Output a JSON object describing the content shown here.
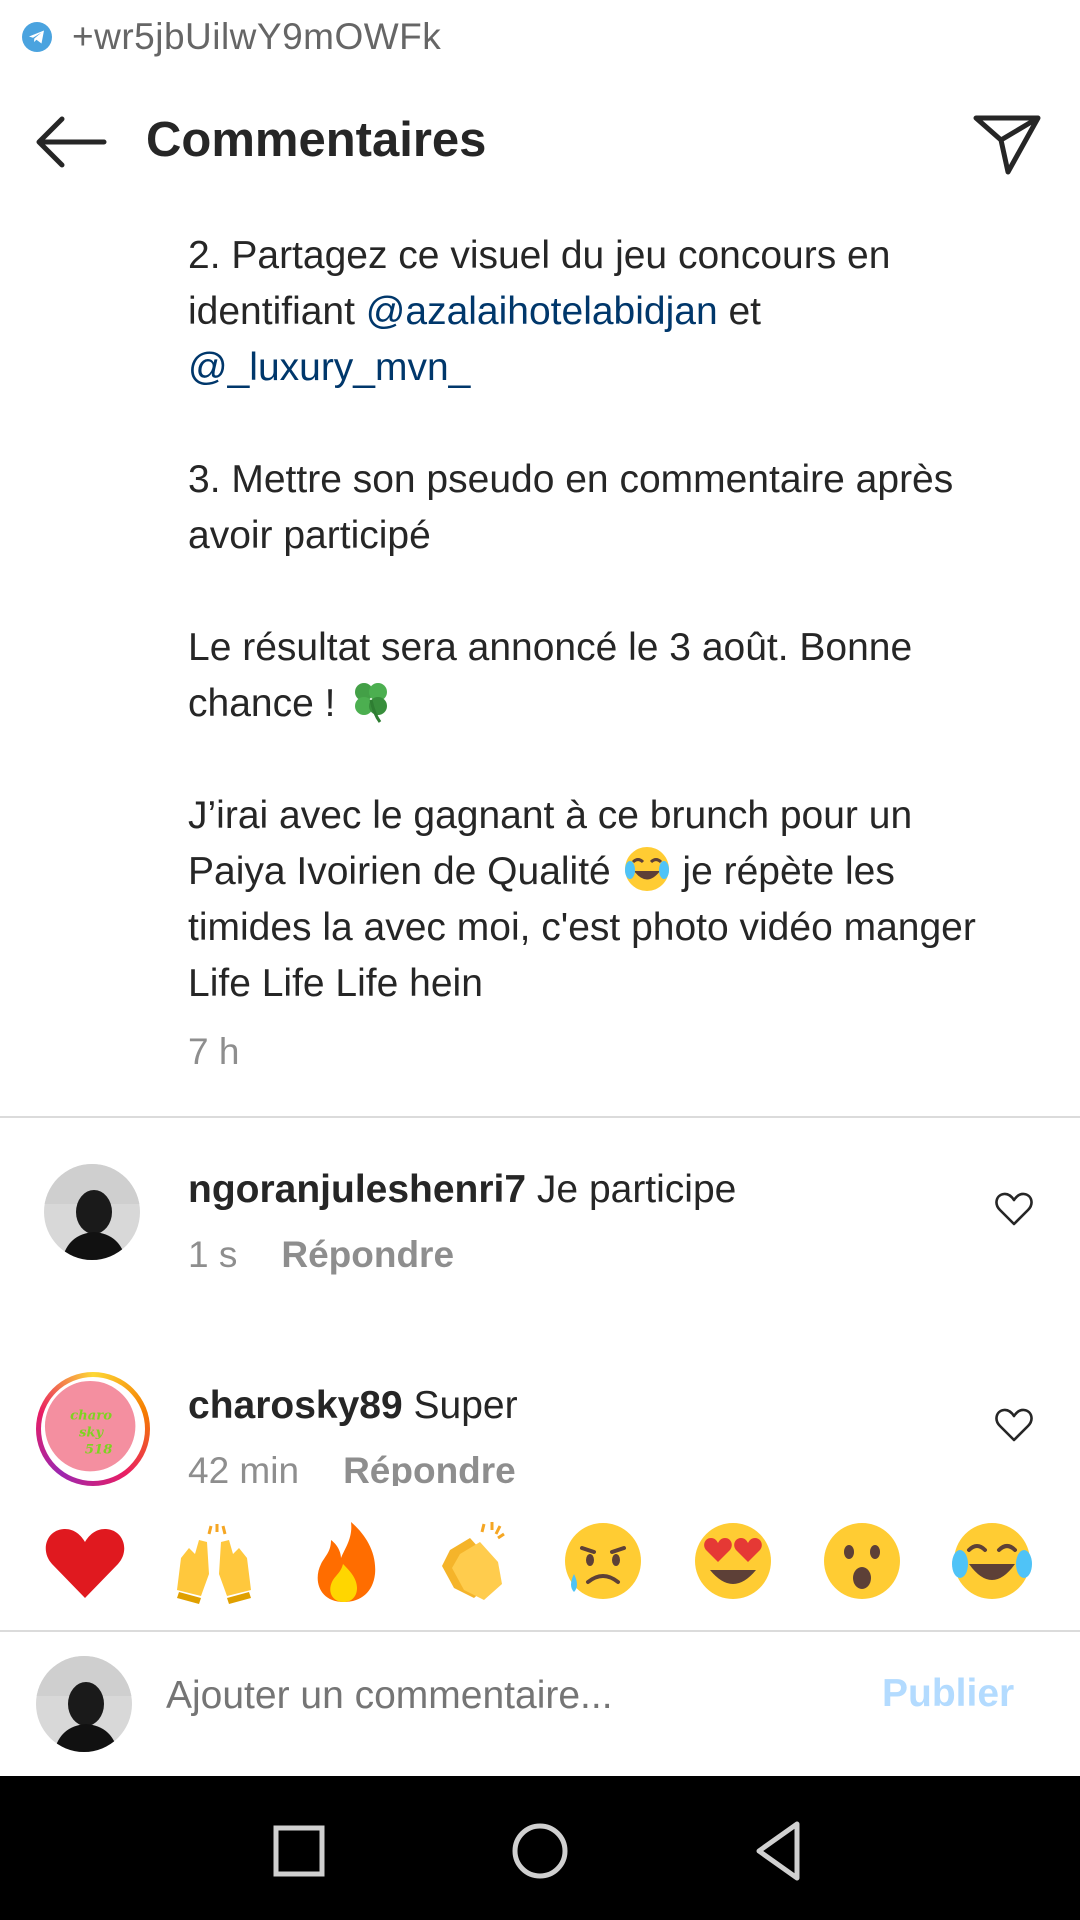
{
  "status_bar": {
    "notification_icon": "telegram-icon",
    "text": "+wr5jbUilwY9mOWFk"
  },
  "header": {
    "back_icon": "arrow-left-icon",
    "title": "Commentaires",
    "share_icon": "paper-plane-icon"
  },
  "caption": {
    "p1_a": "2. Partagez ce visuel du jeu concours en identifiant ",
    "mention1": "@azalaihotelabidjan",
    "p1_b": " et ",
    "mention2": "@_luxury_mvn_",
    "p2": "3. Mettre son pseudo en commentaire après avoir participé",
    "p3": "Le résultat sera annoncé le 3 août. Bonne chance ! ",
    "p3_emoji": "four-leaf-clover-icon",
    "p4_a": "J’irai avec le gagnant à ce brunch  pour un Paiya Ivoirien de Qualité ",
    "p4_emoji": "tears-of-joy-icon",
    "p4_b": " je répète les timides la avec moi, c'est photo vidéo manger Life Life Life hein",
    "time": "7 h"
  },
  "comments": [
    {
      "username": "ngoranjuleshenri7",
      "text": " Je participe",
      "time": "1 s",
      "reply": "Répondre"
    },
    {
      "username": "charosky89",
      "text": " Super",
      "time": "42 min",
      "reply": "Répondre",
      "avatar_text": [
        "charo",
        "sky",
        "518"
      ]
    }
  ],
  "reactions": [
    "heart",
    "raising-hands",
    "fire",
    "clapping-hands",
    "crying-face",
    "heart-eyes",
    "surprised-face",
    "tears-of-joy"
  ],
  "composer": {
    "placeholder": "Ajouter un commentaire...",
    "publish": "Publier"
  },
  "colors": {
    "mention": "#00376b",
    "secondary": "#8e8e8e",
    "publish_disabled": "#b3dbff",
    "navbar": "#000000"
  }
}
